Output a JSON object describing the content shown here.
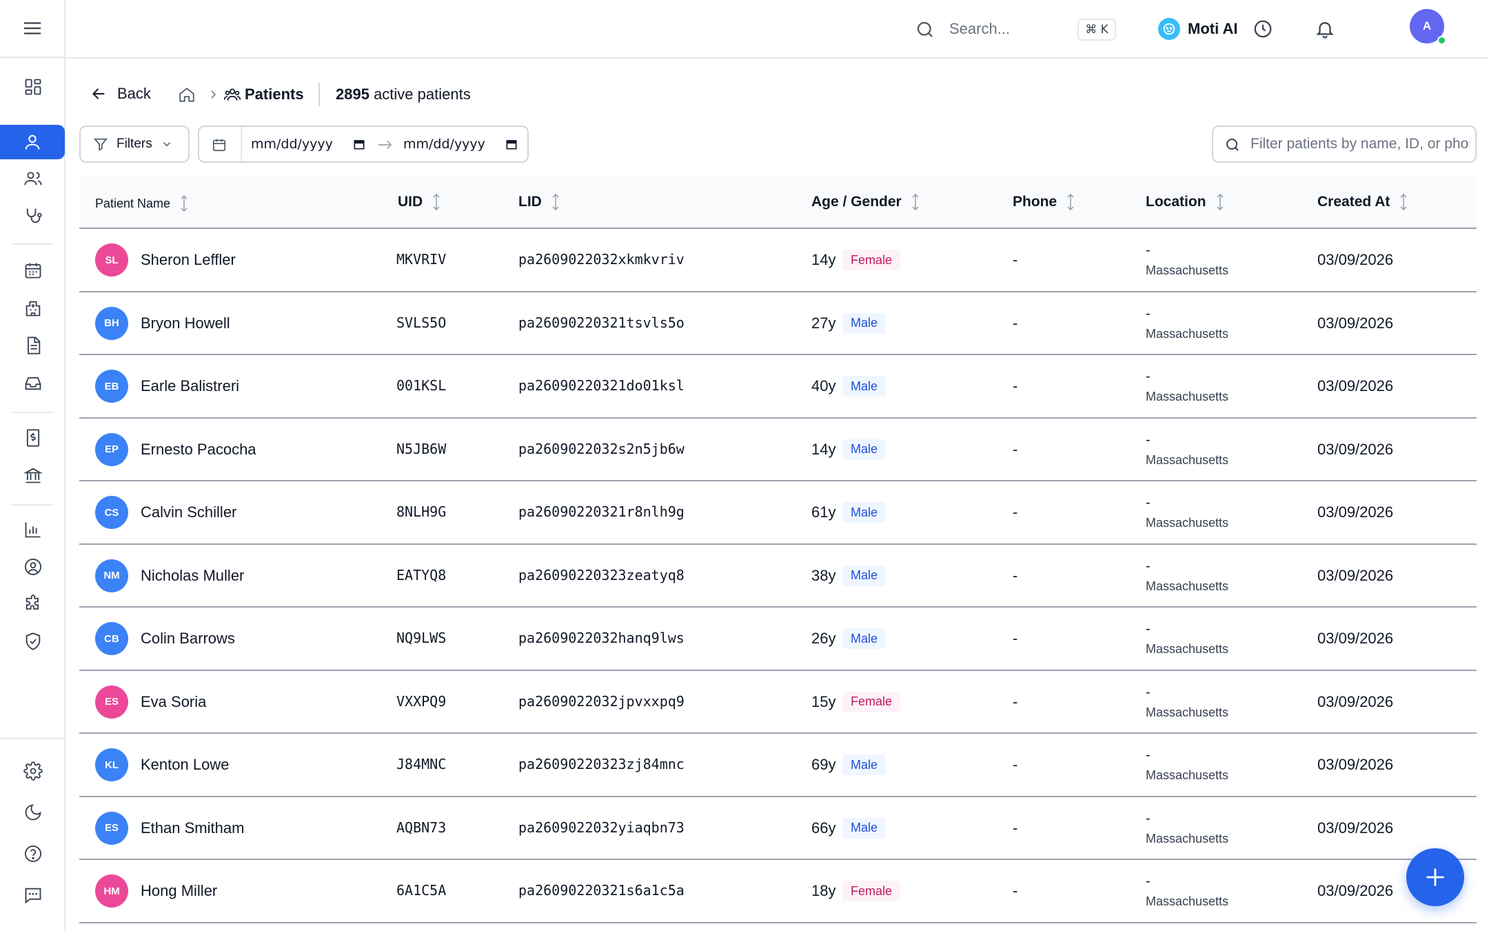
{
  "topbar": {
    "search_placeholder": "Search...",
    "shortcut": "⌘ K",
    "ai_label": "Moti AI",
    "avatar_initial": "A"
  },
  "breadcrumb": {
    "back_label": "Back",
    "page_title": "Patients",
    "count": "2895",
    "count_suffix": " active patients"
  },
  "filters": {
    "button_label": "Filters",
    "date_from": "mm/dd/yyyy",
    "date_to": "mm/dd/yyyy",
    "search_placeholder": "Filter patients by name, ID, or phone"
  },
  "table": {
    "columns": [
      "Patient Name",
      "UID",
      "LID",
      "Age / Gender",
      "Phone",
      "Location",
      "Created At"
    ],
    "rows": [
      {
        "initials": "SL",
        "name": "Sheron Leffler",
        "uid": "MKVRIV",
        "lid": "pa2609022032xkmkvriv",
        "age": "14y",
        "gender": "Female",
        "phone": "-",
        "loc_line1": "-",
        "loc_line2": "Massachusetts",
        "created": "03/09/2026"
      },
      {
        "initials": "BH",
        "name": "Bryon Howell",
        "uid": "SVLS5O",
        "lid": "pa26090220321tsvls5o",
        "age": "27y",
        "gender": "Male",
        "phone": "-",
        "loc_line1": "-",
        "loc_line2": "Massachusetts",
        "created": "03/09/2026"
      },
      {
        "initials": "EB",
        "name": "Earle Balistreri",
        "uid": "001KSL",
        "lid": "pa26090220321do01ksl",
        "age": "40y",
        "gender": "Male",
        "phone": "-",
        "loc_line1": "-",
        "loc_line2": "Massachusetts",
        "created": "03/09/2026"
      },
      {
        "initials": "EP",
        "name": "Ernesto Pacocha",
        "uid": "N5JB6W",
        "lid": "pa2609022032s2n5jb6w",
        "age": "14y",
        "gender": "Male",
        "phone": "-",
        "loc_line1": "-",
        "loc_line2": "Massachusetts",
        "created": "03/09/2026"
      },
      {
        "initials": "CS",
        "name": "Calvin Schiller",
        "uid": "8NLH9G",
        "lid": "pa26090220321r8nlh9g",
        "age": "61y",
        "gender": "Male",
        "phone": "-",
        "loc_line1": "-",
        "loc_line2": "Massachusetts",
        "created": "03/09/2026"
      },
      {
        "initials": "NM",
        "name": "Nicholas Muller",
        "uid": "EATYQ8",
        "lid": "pa26090220323zeatyq8",
        "age": "38y",
        "gender": "Male",
        "phone": "-",
        "loc_line1": "-",
        "loc_line2": "Massachusetts",
        "created": "03/09/2026"
      },
      {
        "initials": "CB",
        "name": "Colin Barrows",
        "uid": "NQ9LWS",
        "lid": "pa2609022032hanq9lws",
        "age": "26y",
        "gender": "Male",
        "phone": "-",
        "loc_line1": "-",
        "loc_line2": "Massachusetts",
        "created": "03/09/2026"
      },
      {
        "initials": "ES",
        "name": "Eva Soria",
        "uid": "VXXPQ9",
        "lid": "pa2609022032jpvxxpq9",
        "age": "15y",
        "gender": "Female",
        "phone": "-",
        "loc_line1": "-",
        "loc_line2": "Massachusetts",
        "created": "03/09/2026"
      },
      {
        "initials": "KL",
        "name": "Kenton Lowe",
        "uid": "J84MNC",
        "lid": "pa26090220323zj84mnc",
        "age": "69y",
        "gender": "Male",
        "phone": "-",
        "loc_line1": "-",
        "loc_line2": "Massachusetts",
        "created": "03/09/2026"
      },
      {
        "initials": "ES",
        "name": "Ethan Smitham",
        "uid": "AQBN73",
        "lid": "pa2609022032yiaqbn73",
        "age": "66y",
        "gender": "Male",
        "phone": "-",
        "loc_line1": "-",
        "loc_line2": "Massachusetts",
        "created": "03/09/2026"
      },
      {
        "initials": "HM",
        "name": "Hong Miller",
        "uid": "6A1C5A",
        "lid": "pa26090220321s6a1c5a",
        "age": "18y",
        "gender": "Female",
        "phone": "-",
        "loc_line1": "-",
        "loc_line2": "Massachusetts",
        "created": "03/09/2026"
      }
    ]
  },
  "colors": {
    "accent": "#2563eb",
    "avatar_male": "#3b82f6",
    "avatar_female": "#ec4899",
    "badge_male_text": "#1d4ed8",
    "badge_female_text": "#be185d"
  },
  "icons": {
    "sidebar": [
      "menu-icon",
      "dashboard-icon",
      "patient-icon",
      "users-icon",
      "stethoscope-icon",
      "calendar-icon",
      "hospital-icon",
      "document-icon",
      "inbox-icon",
      "billing-icon",
      "bank-icon",
      "chart-icon",
      "user-circle-icon",
      "puzzle-icon",
      "shield-icon",
      "settings-icon",
      "moon-icon",
      "help-icon",
      "chat-icon"
    ],
    "fab": "plus-icon"
  }
}
